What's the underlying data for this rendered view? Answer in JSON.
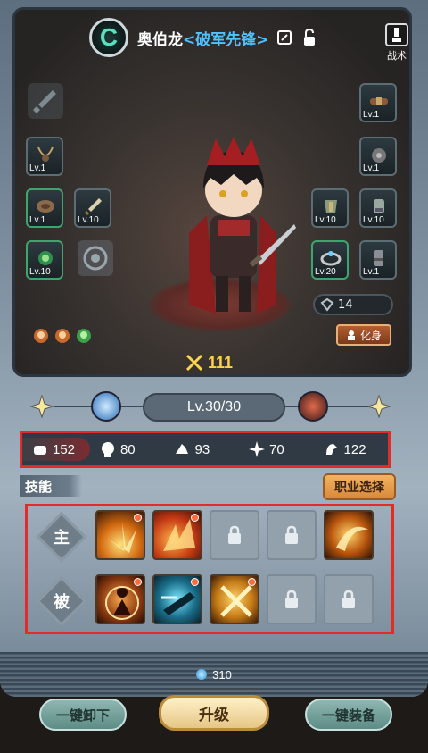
{
  "hero": {
    "rank_letter": "C",
    "name": "奥伯龙",
    "title": "<破军先锋>"
  },
  "tactics": {
    "label": "战术"
  },
  "equipment": {
    "left": [
      {
        "level": "Lv.1",
        "icon": "necklace-icon"
      },
      {
        "level": "Lv.1",
        "icon": "bracer-icon"
      },
      {
        "level": "Lv.10",
        "icon": "dagger-icon"
      },
      {
        "level": "Lv.10",
        "icon": "amulet-icon"
      }
    ],
    "right": [
      {
        "level": "Lv.1",
        "icon": "belt-icon"
      },
      {
        "level": "Lv.1",
        "icon": "pauldron-icon"
      },
      {
        "level": "Lv.10",
        "icon": "chest-armor-icon"
      },
      {
        "level": "Lv.10",
        "icon": "gauntlet-icon"
      },
      {
        "level": "Lv.20",
        "icon": "ring-icon"
      },
      {
        "level": "Lv.1",
        "icon": "greaves-icon"
      }
    ]
  },
  "power_value": "14",
  "transform_label": "化身",
  "attack_value": "111",
  "level_text": "Lv.30/30",
  "stats": [
    {
      "icon": "fist-icon",
      "value": "152"
    },
    {
      "icon": "head-icon",
      "value": "80"
    },
    {
      "icon": "hand-icon",
      "value": "93"
    },
    {
      "icon": "burst-icon",
      "value": "70"
    },
    {
      "icon": "arm-icon",
      "value": "122"
    }
  ],
  "skills_label": "技能",
  "job_button": "职业选择",
  "skill_rows": {
    "active_label": "主",
    "passive_label": "被"
  },
  "resource_value": "310",
  "buttons": {
    "unequip_all": "一键卸下",
    "upgrade": "升级",
    "equip_all": "一键装备"
  },
  "colors": {
    "highlight_border": "#e22b2b",
    "title_blue": "#4fc3ff",
    "attack_gold": "#ffd34d"
  }
}
